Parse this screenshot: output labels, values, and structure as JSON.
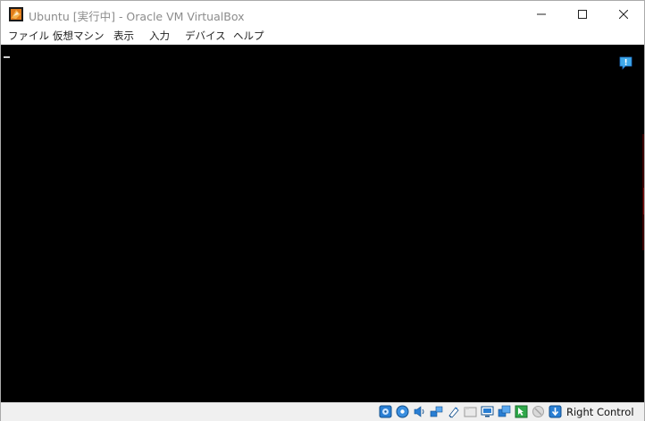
{
  "window": {
    "title": "Ubuntu [実行中] - Oracle VM VirtualBox"
  },
  "menu": {
    "items": [
      "ファイル",
      "仮想マシン",
      "表示",
      "入力",
      "デバイス",
      "ヘルプ"
    ]
  },
  "statusbar": {
    "host_key": "Right Control",
    "icons": [
      "hard-disk-icon",
      "optical-drive-icon",
      "audio-icon",
      "network-icon",
      "usb-icon",
      "shared-folders-icon",
      "display-icon",
      "video-capture-icon",
      "mouse-integration-icon",
      "cpu-virtualization-icon",
      "host-key-arrow-icon"
    ]
  },
  "colors": {
    "vm_background": "#000000",
    "accent": "#1f6fc5",
    "title_text": "#8c8c8c"
  }
}
